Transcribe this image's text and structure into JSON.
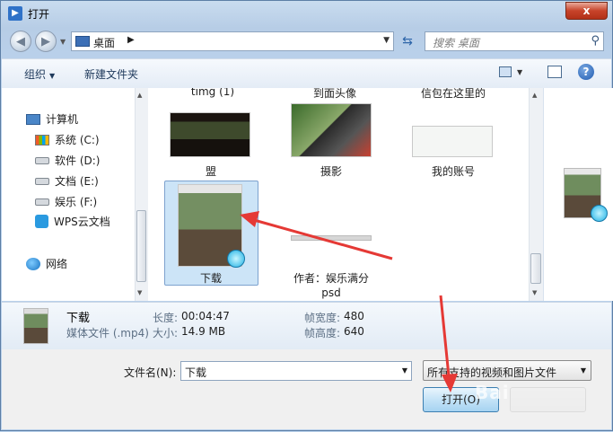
{
  "window": {
    "title": "打开",
    "close_label": "x"
  },
  "nav": {
    "back": "◀",
    "forward": "▶",
    "recent": "▼"
  },
  "address": {
    "location": "桌面",
    "separator": "▶"
  },
  "search": {
    "placeholder": "搜索 桌面"
  },
  "toolbar": {
    "organize": "组织",
    "new_folder": "新建文件夹",
    "help": "?"
  },
  "sidebar": {
    "items": [
      {
        "label": "计算机"
      },
      {
        "label": "系统 (C:)"
      },
      {
        "label": "软件 (D:)"
      },
      {
        "label": "文档 (E:)"
      },
      {
        "label": "娱乐 (F:)"
      },
      {
        "label": "WPS云文档"
      },
      {
        "label": "网络"
      }
    ]
  },
  "files": {
    "top_row": [
      "timg (1)",
      "到面头像",
      "信包在这里的"
    ],
    "items": [
      {
        "label": "盟"
      },
      {
        "label": "摄影"
      },
      {
        "label": "我的账号"
      },
      {
        "label": "下载"
      },
      {
        "label": "作者：娱乐满分"
      },
      {
        "label": "psd"
      }
    ]
  },
  "details": {
    "name": "下载",
    "type": "媒体文件 (.mp4)",
    "length_label": "长度:",
    "length_value": "00:04:47",
    "size_label": "大小:",
    "size_value": "14.9 MB",
    "width_label": "帧宽度:",
    "width_value": "480",
    "height_label": "帧高度:",
    "height_value": "640"
  },
  "bottom": {
    "filename_label": "文件名(N):",
    "filename_value": "下载",
    "filter_value": "所有支持的视频和图片文件",
    "open_label": "打开(O)"
  },
  "watermark": "Bai",
  "colors": {
    "annotation": "#e53935",
    "selection": "#cce4f7"
  }
}
